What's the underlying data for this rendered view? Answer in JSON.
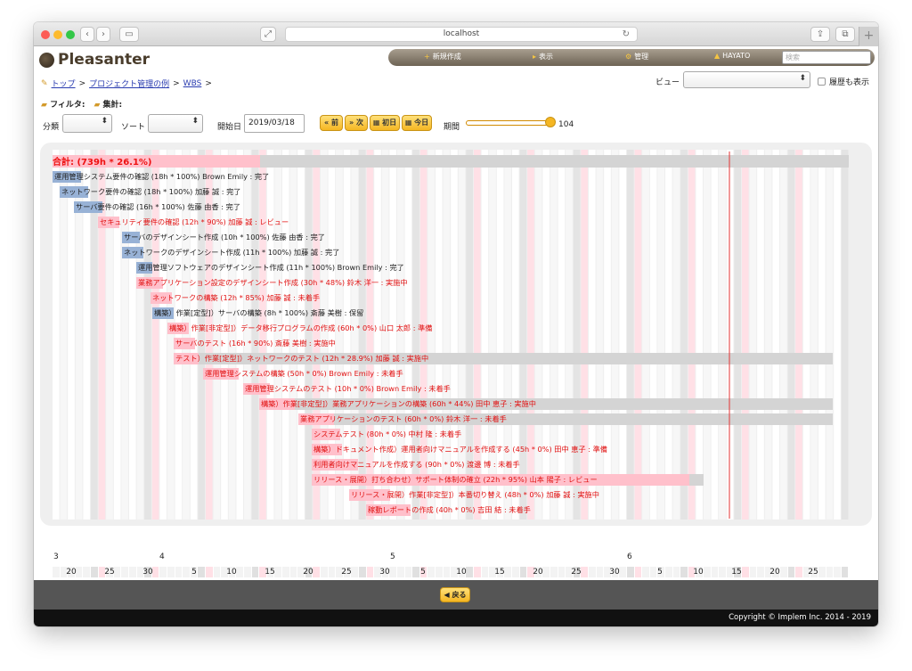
{
  "browser": {
    "address": "localhost"
  },
  "app": {
    "brand": "Pleasanter"
  },
  "nav": {
    "new": "新規作成",
    "view": "表示",
    "manage": "管理",
    "user": "HAYATO",
    "search_placeholder": "検索"
  },
  "breadcrumb": {
    "top": "トップ",
    "project": "プロジェクト管理の例",
    "wbs": "WBS",
    "sep": ">"
  },
  "view_selector": {
    "label": "ビュー",
    "show_history": "履歴も表示"
  },
  "filters": {
    "filter": "フィルタ:",
    "aggregate": "集計:"
  },
  "controls": {
    "category": "分類",
    "sort": "ソート",
    "start_date_label": "開始日",
    "start_date": "2019/03/18",
    "prev": "前",
    "next": "次",
    "first": "初日",
    "today": "今日",
    "period_label": "期間",
    "period_value": "104",
    "period_fraction": 1.0
  },
  "gantt": {
    "total": "合計: (739h * 26.1%)",
    "tasks": [
      {
        "label": "運用管理システム要件の確認 (18h * 100%) Brown Emily : 完了",
        "status": "done"
      },
      {
        "label": "ネットワーク要件の確認 (18h * 100%) 加藤 誠 : 完了",
        "status": "done"
      },
      {
        "label": "サーバ要件の確認 (16h * 100%) 佐藤 由香 : 完了",
        "status": "done"
      },
      {
        "label": "セキュリティ要件の確認 (12h * 90%) 加藤 誠 : レビュー",
        "status": "late"
      },
      {
        "label": "サーバのデザインシート作成 (10h * 100%) 佐藤 由香 : 完了",
        "status": "done"
      },
      {
        "label": "ネットワークのデザインシート作成 (11h * 100%) 加藤 誠 : 完了",
        "status": "done"
      },
      {
        "label": "運用管理ソフトウェアのデザインシート作成 (11h * 100%) Brown Emily : 完了",
        "status": "done"
      },
      {
        "label": "業務アプリケーション設定のデザインシート作成 (30h * 48%) 鈴木 洋一 : 実施中",
        "status": "late"
      },
      {
        "label": "ネットワークの構築 (12h * 85%) 加藤 誠 : 未着手",
        "status": "late"
      },
      {
        "label": "構築）作業[定型]）サーバの構築 (8h * 100%) 斎藤 美樹 : 保留",
        "status": "done"
      },
      {
        "label": "構築）作業[非定型]）データ移行プログラムの作成 (60h * 0%) 山口 太郎 : 準備",
        "status": "late"
      },
      {
        "label": "サーバのテスト (16h * 90%) 斎藤 美樹 : 実施中",
        "status": "late"
      },
      {
        "label": "テスト）作業[定型]）ネットワークのテスト (12h * 28.9%) 加藤 誠 : 実施中",
        "status": "late"
      },
      {
        "label": "運用管理システムの構築 (50h * 0%) Brown Emily : 未着手",
        "status": "late"
      },
      {
        "label": "運用管理システムのテスト (10h * 0%) Brown Emily : 未着手",
        "status": "late"
      },
      {
        "label": "構築）作業[非定型]）業務アプリケーションの構築 (60h * 44%) 田中 恵子 : 実施中",
        "status": "late"
      },
      {
        "label": "業務アプリケーションのテスト (60h * 0%) 鈴木 洋一 : 未着手",
        "status": "late"
      },
      {
        "label": "システムテスト (80h * 0%) 中村 隆 : 未着手",
        "status": "late"
      },
      {
        "label": "構築）ドキュメント作成）運用者向けマニュアルを作成する (45h * 0%) 田中 恵子 : 準備",
        "status": "late"
      },
      {
        "label": "利用者向けマニュアルを作成する (90h * 0%) 渡邊 博 : 未着手",
        "status": "late"
      },
      {
        "label": "リリース・展開）打ち合わせ）サポート体制の確立 (22h * 95%) 山本 陽子 : レビュー",
        "status": "late"
      },
      {
        "label": "リリース・展開）作業[非定型]）本番切り替え (48h * 0%) 加藤 誠 : 実施中",
        "status": "late"
      },
      {
        "label": "稼動レポートの作成 (40h * 0%) 吉田 結 : 未着手",
        "status": "late"
      }
    ]
  },
  "axis": {
    "months": [
      "3",
      "4",
      "5",
      "6"
    ],
    "days": [
      "20",
      "25",
      "30",
      "5",
      "10",
      "15",
      "20",
      "25",
      "30",
      "5",
      "10",
      "15",
      "20",
      "25",
      "30",
      "5",
      "10",
      "15",
      "20",
      "25"
    ]
  },
  "footer": {
    "back": "戻る",
    "copyright": "Copyright © Implem Inc. 2014 - 2019"
  },
  "colors": {
    "done": "#98b2d6",
    "late": "#ffc0cb",
    "late_text": "#e11111",
    "today_line": "#e33333"
  }
}
